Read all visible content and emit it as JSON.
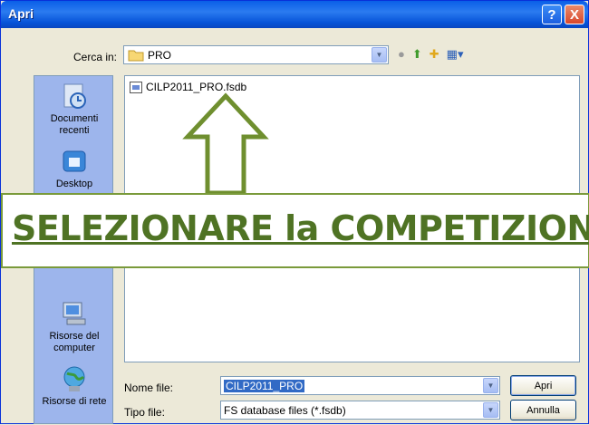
{
  "window": {
    "title": "Apri"
  },
  "title_buttons": {
    "help": "?",
    "close": "X"
  },
  "look_in": {
    "label": "Cerca in:",
    "value": "PRO"
  },
  "places": [
    {
      "label": "Documenti recenti",
      "icon": "recent-documents-icon"
    },
    {
      "label": "Desktop",
      "icon": "desktop-icon"
    },
    {
      "label": "Risorse del computer",
      "icon": "my-computer-icon"
    },
    {
      "label": "Risorse di rete",
      "icon": "network-icon"
    }
  ],
  "files": [
    {
      "name": "CILP2011_PRO.fsdb"
    }
  ],
  "file_name": {
    "label": "Nome file:",
    "value": "CILP2011_PRO"
  },
  "file_type": {
    "label": "Tipo file:",
    "value": "FS database files (*.fsdb)"
  },
  "buttons": {
    "open": "Apri",
    "cancel": "Annulla"
  },
  "annotation": {
    "text": "SELEZIONARE la COMPETIZIONE",
    "color": "#4f7324"
  }
}
